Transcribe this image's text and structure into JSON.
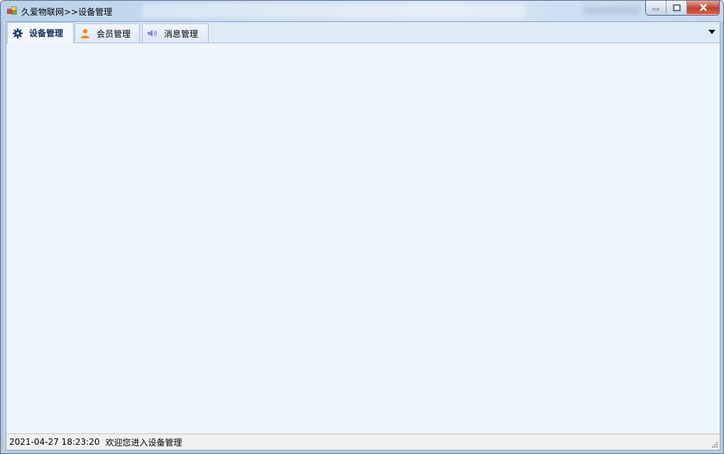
{
  "window": {
    "title": "久爱物联网>>设备管理",
    "controls": {
      "minimize_icon": "minimize-icon",
      "maximize_icon": "maximize-icon",
      "close_icon": "close-icon"
    }
  },
  "tabs": [
    {
      "label": "设备管理",
      "icon": "gear-icon",
      "active": true
    },
    {
      "label": "会员管理",
      "icon": "user-icon",
      "active": false
    },
    {
      "label": "消息管理",
      "icon": "speaker-icon",
      "active": false
    }
  ],
  "tab_dropdown_icon": "dropdown-arrow-icon",
  "statusbar": {
    "datetime": "2021-04-27 18:23:20",
    "message": "欢迎您进入设备管理"
  },
  "colors": {
    "content_bg": "#eef5fd",
    "active_tab_text": "#15305a",
    "user_icon": "#f08a1d",
    "speaker_icon": "#8a86d8",
    "close_button": "#c3422e"
  }
}
